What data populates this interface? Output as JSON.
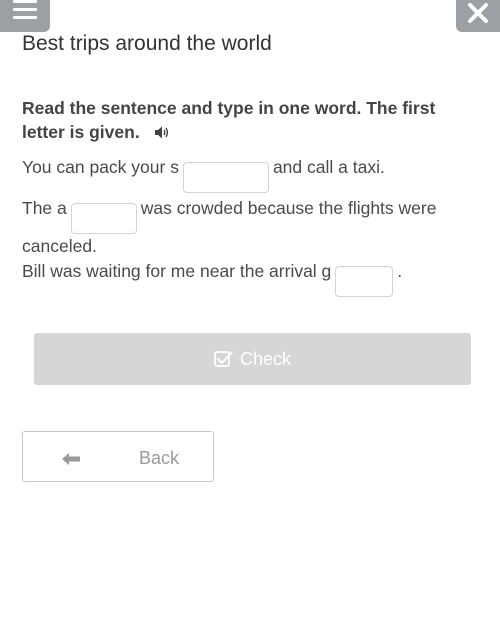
{
  "header": {
    "menu_icon": "hamburger-menu-icon",
    "close_icon": "close-icon",
    "title": "Best trips around the world"
  },
  "exercise": {
    "instruction": "Read the sentence and type in one word. The first letter is given.",
    "audio_icon": "speaker-icon",
    "sentences": [
      {
        "before": "You can pack your s",
        "after": "and call a taxi.",
        "value": ""
      },
      {
        "before": "The a",
        "after": "was crowded because the flights were canceled.",
        "value": ""
      },
      {
        "before": "Bill was waiting for me near the arrival g",
        "after": ".",
        "value": ""
      }
    ]
  },
  "actions": {
    "check_label": "Check",
    "check_icon": "check-square-icon",
    "back_label": "Back",
    "back_icon": "arrow-left-icon"
  },
  "colors": {
    "header_button_bg": "#9aa0a4",
    "check_button_bg": "#d6d6d6",
    "text": "#444444"
  }
}
